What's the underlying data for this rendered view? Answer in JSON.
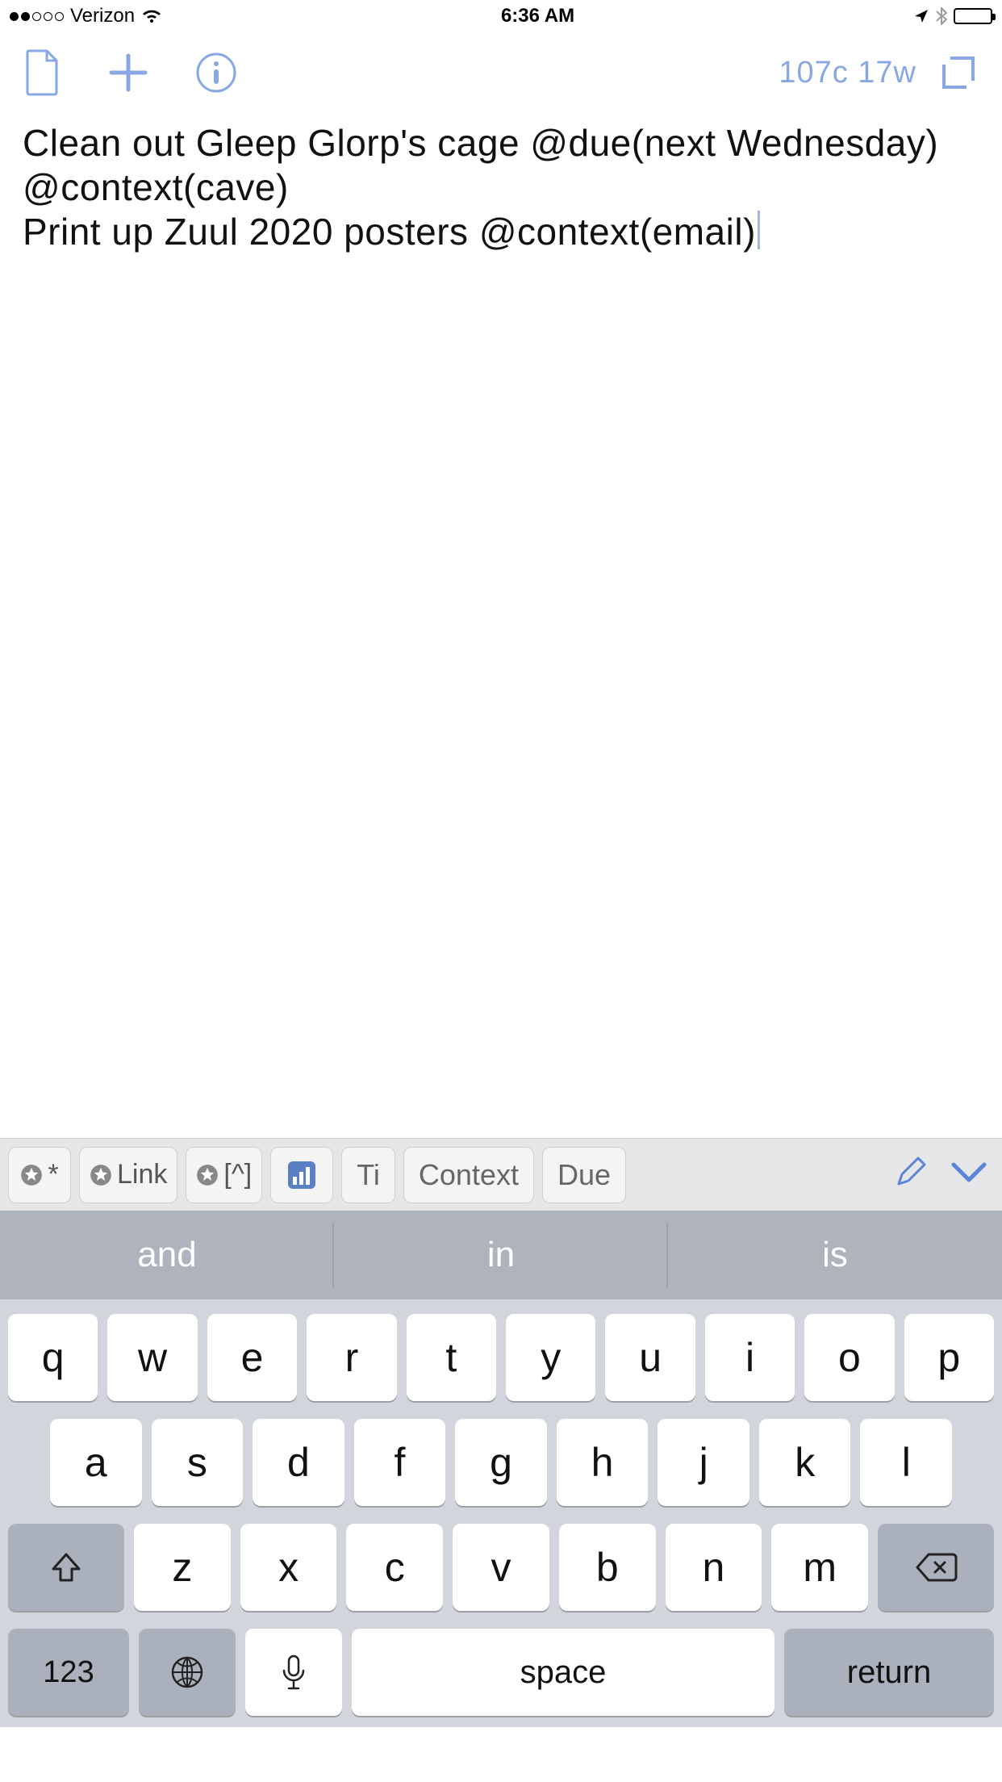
{
  "status": {
    "carrier": "Verizon",
    "time": "6:36 AM"
  },
  "toolbar": {
    "count_chars": "107c",
    "count_words": "17w"
  },
  "editor": {
    "line1": "Clean out Gleep Glorp's cage @due(next Wednesday) @context(cave)",
    "line2": "Print up Zuul 2020 posters @context(email)"
  },
  "accessory": {
    "asterisk": "*",
    "link": "Link",
    "caret": "[^]",
    "ti": "Ti",
    "context": "Context",
    "due": "Due"
  },
  "suggestions": [
    "and",
    "in",
    "is"
  ],
  "keyboard": {
    "row1": [
      "q",
      "w",
      "e",
      "r",
      "t",
      "y",
      "u",
      "i",
      "o",
      "p"
    ],
    "row2": [
      "a",
      "s",
      "d",
      "f",
      "g",
      "h",
      "j",
      "k",
      "l"
    ],
    "row3": [
      "z",
      "x",
      "c",
      "v",
      "b",
      "n",
      "m"
    ],
    "numbers": "123",
    "space": "space",
    "return": "return"
  }
}
